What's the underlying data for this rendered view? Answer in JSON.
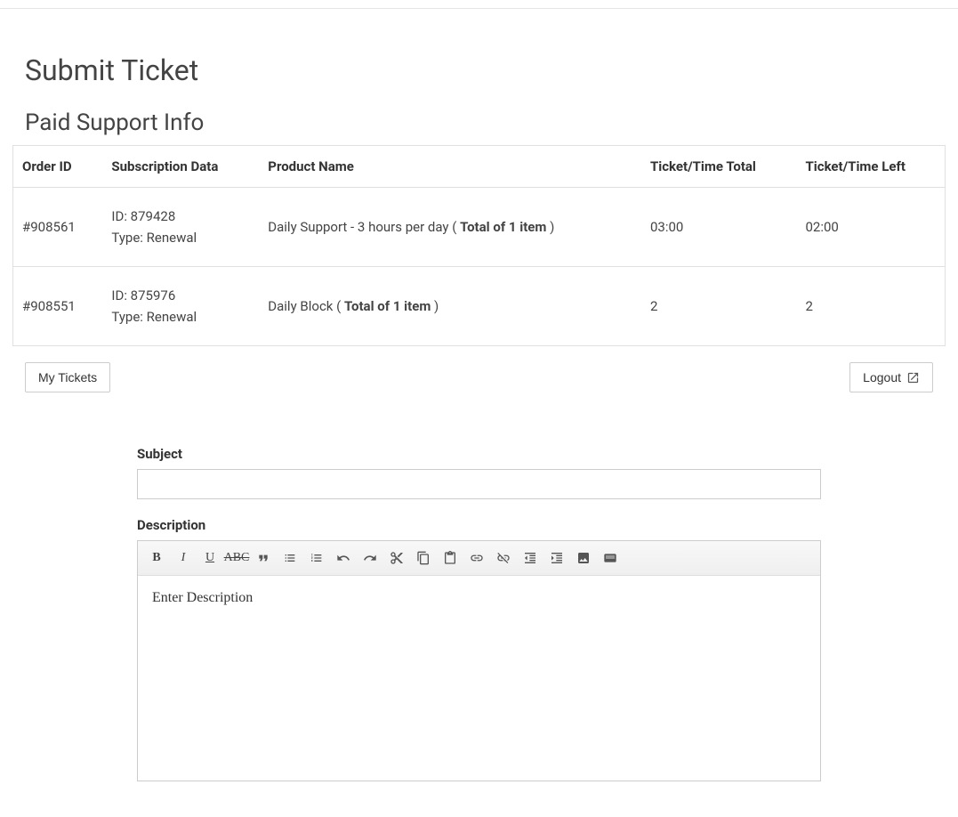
{
  "page_title": "Submit Ticket",
  "section_title": "Paid Support Info",
  "table": {
    "headers": {
      "order_id": "Order ID",
      "subscription": "Subscription Data",
      "product": "Product Name",
      "total": "Ticket/Time Total",
      "left": "Ticket/Time Left"
    },
    "rows": [
      {
        "order_id": "#908561",
        "sub_id_label": "ID: ",
        "sub_id": "879428",
        "sub_type_label": "Type: ",
        "sub_type": "Renewal",
        "product_prefix": "Daily Support - 3 hours per day ( ",
        "product_bold": "Total of 1 item",
        "product_suffix": " )",
        "total": "03:00",
        "left": "02:00"
      },
      {
        "order_id": "#908551",
        "sub_id_label": "ID: ",
        "sub_id": "875976",
        "sub_type_label": "Type: ",
        "sub_type": "Renewal",
        "product_prefix": "Daily Block ( ",
        "product_bold": "Total of 1 item",
        "product_suffix": " )",
        "total": "2",
        "left": "2"
      }
    ]
  },
  "buttons": {
    "my_tickets": "My Tickets",
    "logout": "Logout"
  },
  "form": {
    "subject_label": "Subject",
    "subject_value": "",
    "description_label": "Description",
    "description_placeholder": "Enter Description"
  },
  "toolbar_icons": {
    "bold": "B",
    "italic": "I",
    "underline": "U",
    "strike": "ABC"
  }
}
